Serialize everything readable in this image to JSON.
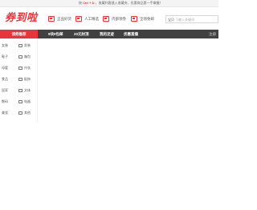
{
  "topbar": {
    "prefix": "按",
    "shortcut": "Ctrl + D",
    "message": "，收藏利客逸入收藏夹，优惠商品第一手掌握！"
  },
  "header": {
    "logo": "券到啦",
    "features": [
      {
        "icon": "quality-badge-icon",
        "label": "正品好货"
      },
      {
        "icon": "person-icon",
        "label": "人工精选"
      },
      {
        "icon": "coupon-icon",
        "label": "内部领券"
      },
      {
        "icon": "discount-icon",
        "label": "全场免邮"
      }
    ],
    "search": {
      "type": "宝贝",
      "placeholder": "输入关键词"
    }
  },
  "nav": {
    "category_label": "领券推荐",
    "items": [
      "9块9包邮",
      "20元封顶",
      "我的足迹",
      "优惠直播"
    ],
    "right_label": "注册"
  },
  "sidebar": {
    "categories": [
      [
        "女装",
        "男装"
      ],
      [
        "鞋子",
        "箱包"
      ],
      [
        "母婴",
        "内衣"
      ],
      [
        "食品",
        "配饰"
      ],
      [
        "居家",
        "文体"
      ],
      [
        "数码",
        "电器"
      ],
      [
        "美妆",
        "其他"
      ]
    ]
  },
  "colors": {
    "accent": "#e8353b",
    "nav_bg": "#414141"
  }
}
